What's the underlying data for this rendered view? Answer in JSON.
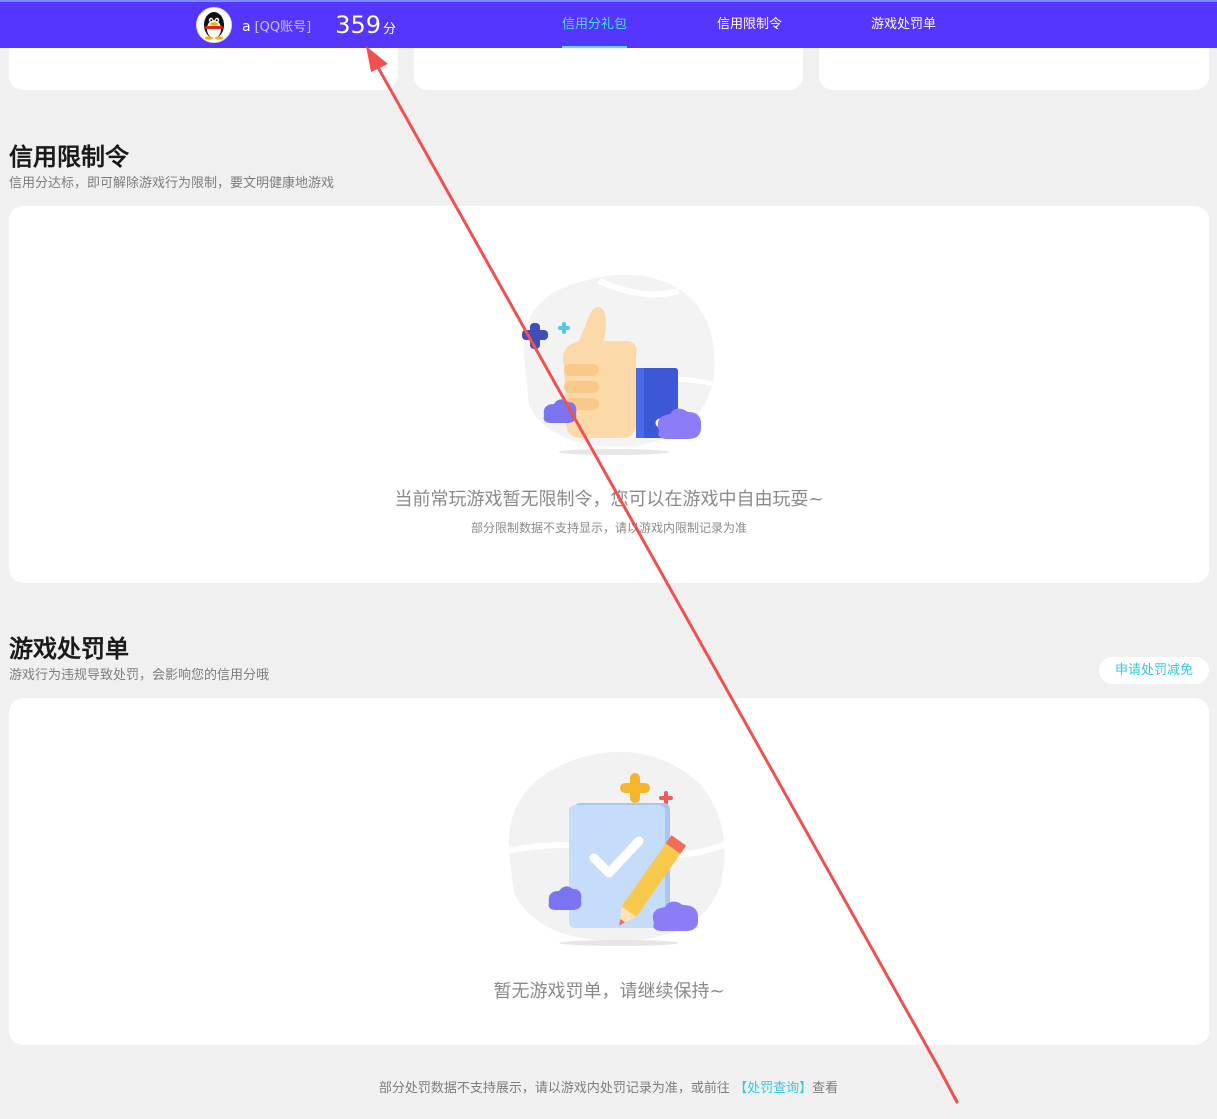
{
  "header": {
    "username": "a",
    "account_type": "[QQ账号]",
    "score": "359",
    "score_unit": "分",
    "nav": [
      {
        "label": "信用分礼包",
        "active": true
      },
      {
        "label": "信用限制令",
        "active": false
      },
      {
        "label": "游戏处罚单",
        "active": false
      }
    ]
  },
  "restriction": {
    "title": "信用限制令",
    "subtitle": "信用分达标，即可解除游戏行为限制，要文明健康地游戏",
    "empty_title": "当前常玩游戏暂无限制令，您可以在游戏中自由玩耍~",
    "empty_note": "部分限制数据不支持显示，请以游戏内限制记录为准"
  },
  "penalty": {
    "title": "游戏处罚单",
    "subtitle": "游戏行为违规导致处罚，会影响您的信用分哦",
    "appeal_label": "申请处罚减免",
    "empty_title": "暂无游戏罚单，请继续保持~"
  },
  "footer": {
    "text_before": "部分处罚数据不支持展示，请以游戏内处罚记录为准，或前往",
    "link": "【处罚查询】",
    "text_after": "查看"
  },
  "colors": {
    "topbar": "#5436ff",
    "accent": "#49e0ff",
    "link": "#37c4e6",
    "annotation_arrow": "#f05050"
  }
}
